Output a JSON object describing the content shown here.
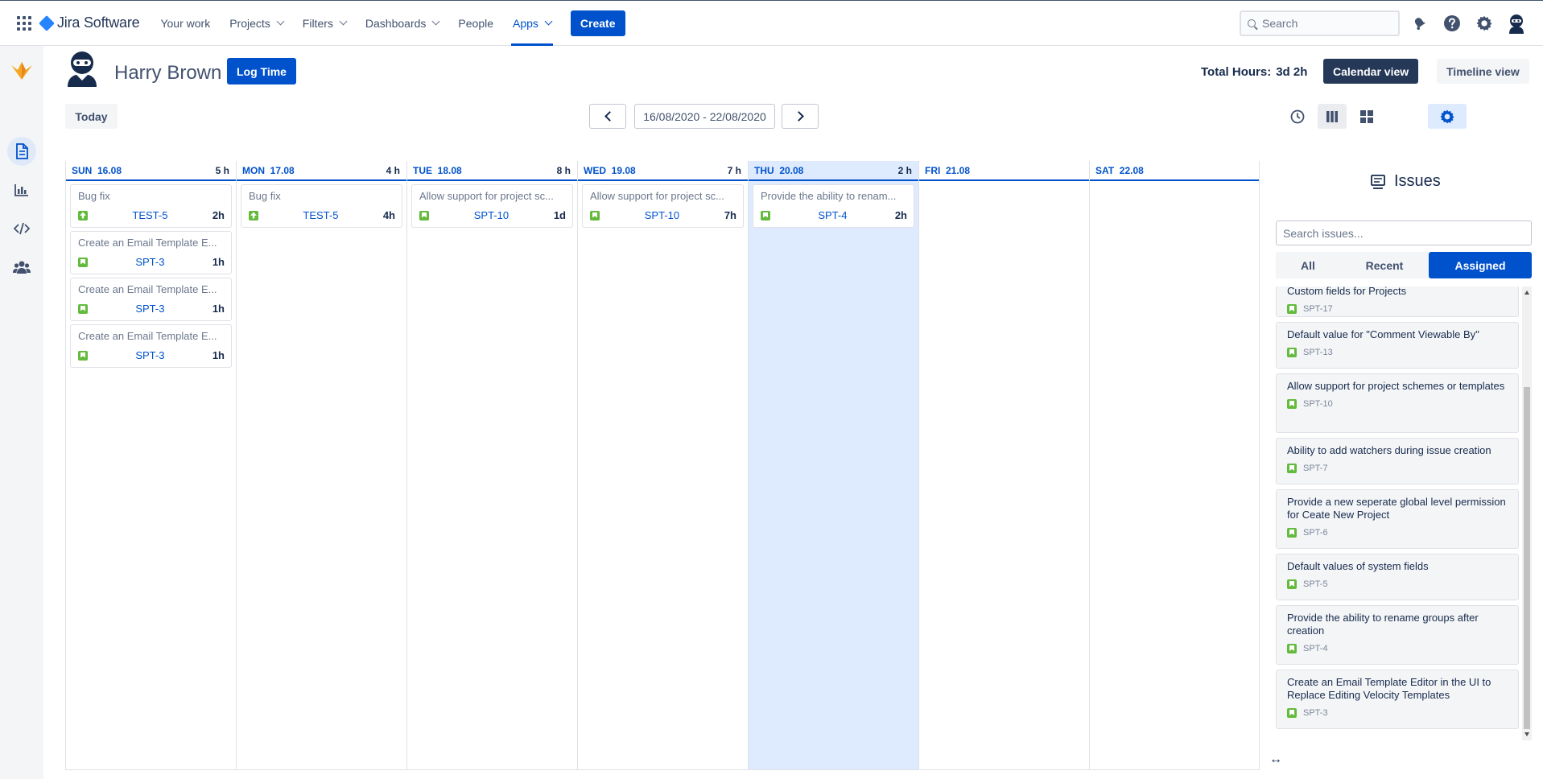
{
  "topbar": {
    "product": "Jira Software",
    "nav": [
      {
        "label": "Your work",
        "dropdown": false,
        "active": false
      },
      {
        "label": "Projects",
        "dropdown": true,
        "active": false
      },
      {
        "label": "Filters",
        "dropdown": true,
        "active": false
      },
      {
        "label": "Dashboards",
        "dropdown": true,
        "active": false
      },
      {
        "label": "People",
        "dropdown": false,
        "active": false
      },
      {
        "label": "Apps",
        "dropdown": true,
        "active": true
      }
    ],
    "create_label": "Create",
    "search_placeholder": "Search",
    "icons": [
      "notifications-icon",
      "help-icon",
      "settings-icon",
      "profile-icon"
    ]
  },
  "sidebar": {
    "logo": "app-logo-icon",
    "items": [
      "timesheet-icon",
      "reports-icon",
      "code-icon",
      "team-icon"
    ]
  },
  "header": {
    "user_name": "Harry Brown",
    "log_time_label": "Log Time",
    "total_hours_label": "Total Hours:",
    "total_hours_value": "3d 2h",
    "calendar_view_label": "Calendar view",
    "timeline_view_label": "Timeline view"
  },
  "toolbar": {
    "today_label": "Today",
    "date_range": "16/08/2020 - 22/08/2020"
  },
  "calendar": {
    "days": [
      {
        "label": "SUN  16.08",
        "hours": "5 h",
        "today": false,
        "entries": [
          {
            "title": "Bug fix",
            "key": "TEST-5",
            "hours": "2h",
            "type": "improvement"
          },
          {
            "title": "Create an Email Template E...",
            "key": "SPT-3",
            "hours": "1h",
            "type": "story"
          },
          {
            "title": "Create an Email Template E...",
            "key": "SPT-3",
            "hours": "1h",
            "type": "story"
          },
          {
            "title": "Create an Email Template E...",
            "key": "SPT-3",
            "hours": "1h",
            "type": "story"
          }
        ]
      },
      {
        "label": "MON  17.08",
        "hours": "4 h",
        "today": false,
        "entries": [
          {
            "title": "Bug fix",
            "key": "TEST-5",
            "hours": "4h",
            "type": "improvement"
          }
        ]
      },
      {
        "label": "TUE  18.08",
        "hours": "8 h",
        "today": false,
        "entries": [
          {
            "title": "Allow support for project sc...",
            "key": "SPT-10",
            "hours": "1d",
            "type": "story"
          }
        ]
      },
      {
        "label": "WED  19.08",
        "hours": "7 h",
        "today": false,
        "entries": [
          {
            "title": "Allow support for project sc...",
            "key": "SPT-10",
            "hours": "7h",
            "type": "story"
          }
        ]
      },
      {
        "label": "THU  20.08",
        "hours": "2 h",
        "today": true,
        "entries": [
          {
            "title": "Provide the ability to renam...",
            "key": "SPT-4",
            "hours": "2h",
            "type": "story"
          }
        ]
      },
      {
        "label": "FRI  21.08",
        "hours": "",
        "today": false,
        "entries": []
      },
      {
        "label": "SAT  22.08",
        "hours": "",
        "today": false,
        "entries": []
      }
    ]
  },
  "issues": {
    "title": "Issues",
    "search_placeholder": "Search issues...",
    "tabs": [
      {
        "label": "All",
        "active": false
      },
      {
        "label": "Recent",
        "active": false
      },
      {
        "label": "Assigned",
        "active": true
      }
    ],
    "items": [
      {
        "title": "Custom fields for Projects",
        "key": "SPT-17"
      },
      {
        "title": "Default value for \"Comment Viewable By\"",
        "key": "SPT-13"
      },
      {
        "title": "Allow support for project schemes or templates",
        "key": "SPT-10"
      },
      {
        "title": "Ability to add watchers during issue creation",
        "key": "SPT-7"
      },
      {
        "title": "Provide a new seperate global level permission for Ceate New Project",
        "key": "SPT-6"
      },
      {
        "title": "Default values of system fields",
        "key": "SPT-5"
      },
      {
        "title": "Provide the ability to rename groups after creation",
        "key": "SPT-4"
      },
      {
        "title": "Create an Email Template Editor in the UI to Replace Editing Velocity Templates",
        "key": "SPT-3"
      }
    ],
    "resize_label": "↔"
  },
  "colors": {
    "primary": "#0052cc",
    "dark": "#253858",
    "today_bg": "#deebff",
    "story_green": "#63ba3c"
  }
}
